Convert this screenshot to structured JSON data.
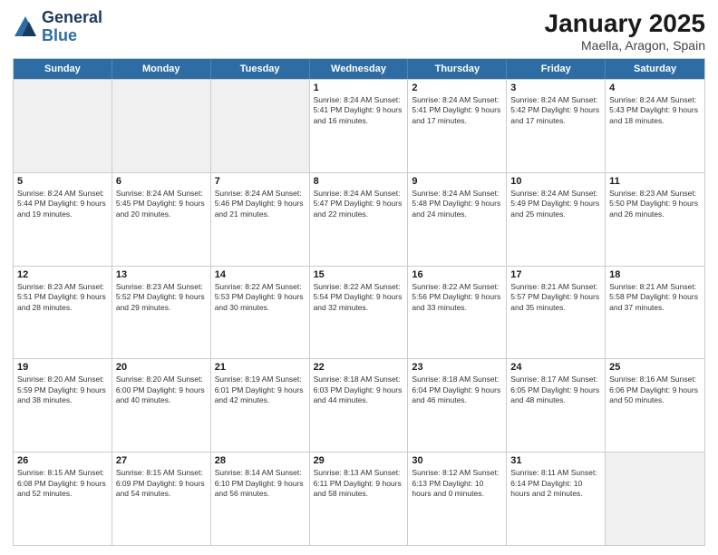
{
  "logo": {
    "line1": "General",
    "line2": "Blue"
  },
  "title": "January 2025",
  "subtitle": "Maella, Aragon, Spain",
  "header_days": [
    "Sunday",
    "Monday",
    "Tuesday",
    "Wednesday",
    "Thursday",
    "Friday",
    "Saturday"
  ],
  "rows": [
    [
      {
        "day": "",
        "info": "",
        "shaded": true
      },
      {
        "day": "",
        "info": "",
        "shaded": true
      },
      {
        "day": "",
        "info": "",
        "shaded": true
      },
      {
        "day": "1",
        "info": "Sunrise: 8:24 AM\nSunset: 5:41 PM\nDaylight: 9 hours and 16 minutes."
      },
      {
        "day": "2",
        "info": "Sunrise: 8:24 AM\nSunset: 5:41 PM\nDaylight: 9 hours and 17 minutes."
      },
      {
        "day": "3",
        "info": "Sunrise: 8:24 AM\nSunset: 5:42 PM\nDaylight: 9 hours and 17 minutes."
      },
      {
        "day": "4",
        "info": "Sunrise: 8:24 AM\nSunset: 5:43 PM\nDaylight: 9 hours and 18 minutes."
      }
    ],
    [
      {
        "day": "5",
        "info": "Sunrise: 8:24 AM\nSunset: 5:44 PM\nDaylight: 9 hours and 19 minutes."
      },
      {
        "day": "6",
        "info": "Sunrise: 8:24 AM\nSunset: 5:45 PM\nDaylight: 9 hours and 20 minutes."
      },
      {
        "day": "7",
        "info": "Sunrise: 8:24 AM\nSunset: 5:46 PM\nDaylight: 9 hours and 21 minutes."
      },
      {
        "day": "8",
        "info": "Sunrise: 8:24 AM\nSunset: 5:47 PM\nDaylight: 9 hours and 22 minutes."
      },
      {
        "day": "9",
        "info": "Sunrise: 8:24 AM\nSunset: 5:48 PM\nDaylight: 9 hours and 24 minutes."
      },
      {
        "day": "10",
        "info": "Sunrise: 8:24 AM\nSunset: 5:49 PM\nDaylight: 9 hours and 25 minutes."
      },
      {
        "day": "11",
        "info": "Sunrise: 8:23 AM\nSunset: 5:50 PM\nDaylight: 9 hours and 26 minutes."
      }
    ],
    [
      {
        "day": "12",
        "info": "Sunrise: 8:23 AM\nSunset: 5:51 PM\nDaylight: 9 hours and 28 minutes."
      },
      {
        "day": "13",
        "info": "Sunrise: 8:23 AM\nSunset: 5:52 PM\nDaylight: 9 hours and 29 minutes."
      },
      {
        "day": "14",
        "info": "Sunrise: 8:22 AM\nSunset: 5:53 PM\nDaylight: 9 hours and 30 minutes."
      },
      {
        "day": "15",
        "info": "Sunrise: 8:22 AM\nSunset: 5:54 PM\nDaylight: 9 hours and 32 minutes."
      },
      {
        "day": "16",
        "info": "Sunrise: 8:22 AM\nSunset: 5:56 PM\nDaylight: 9 hours and 33 minutes."
      },
      {
        "day": "17",
        "info": "Sunrise: 8:21 AM\nSunset: 5:57 PM\nDaylight: 9 hours and 35 minutes."
      },
      {
        "day": "18",
        "info": "Sunrise: 8:21 AM\nSunset: 5:58 PM\nDaylight: 9 hours and 37 minutes."
      }
    ],
    [
      {
        "day": "19",
        "info": "Sunrise: 8:20 AM\nSunset: 5:59 PM\nDaylight: 9 hours and 38 minutes."
      },
      {
        "day": "20",
        "info": "Sunrise: 8:20 AM\nSunset: 6:00 PM\nDaylight: 9 hours and 40 minutes."
      },
      {
        "day": "21",
        "info": "Sunrise: 8:19 AM\nSunset: 6:01 PM\nDaylight: 9 hours and 42 minutes."
      },
      {
        "day": "22",
        "info": "Sunrise: 8:18 AM\nSunset: 6:03 PM\nDaylight: 9 hours and 44 minutes."
      },
      {
        "day": "23",
        "info": "Sunrise: 8:18 AM\nSunset: 6:04 PM\nDaylight: 9 hours and 46 minutes."
      },
      {
        "day": "24",
        "info": "Sunrise: 8:17 AM\nSunset: 6:05 PM\nDaylight: 9 hours and 48 minutes."
      },
      {
        "day": "25",
        "info": "Sunrise: 8:16 AM\nSunset: 6:06 PM\nDaylight: 9 hours and 50 minutes."
      }
    ],
    [
      {
        "day": "26",
        "info": "Sunrise: 8:15 AM\nSunset: 6:08 PM\nDaylight: 9 hours and 52 minutes."
      },
      {
        "day": "27",
        "info": "Sunrise: 8:15 AM\nSunset: 6:09 PM\nDaylight: 9 hours and 54 minutes."
      },
      {
        "day": "28",
        "info": "Sunrise: 8:14 AM\nSunset: 6:10 PM\nDaylight: 9 hours and 56 minutes."
      },
      {
        "day": "29",
        "info": "Sunrise: 8:13 AM\nSunset: 6:11 PM\nDaylight: 9 hours and 58 minutes."
      },
      {
        "day": "30",
        "info": "Sunrise: 8:12 AM\nSunset: 6:13 PM\nDaylight: 10 hours and 0 minutes."
      },
      {
        "day": "31",
        "info": "Sunrise: 8:11 AM\nSunset: 6:14 PM\nDaylight: 10 hours and 2 minutes."
      },
      {
        "day": "",
        "info": "",
        "shaded": true
      }
    ]
  ]
}
